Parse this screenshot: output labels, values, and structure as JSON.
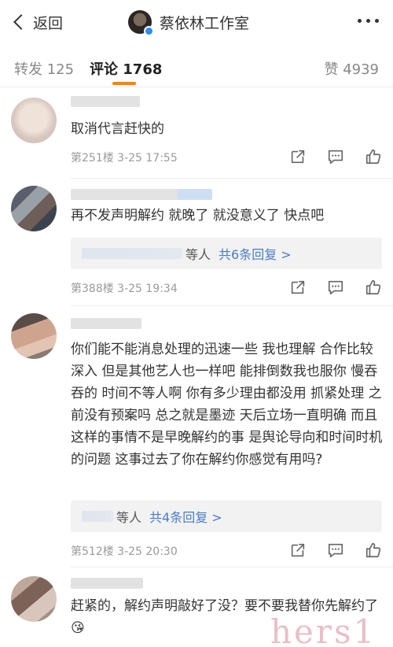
{
  "header": {
    "back_label": "返回",
    "title": "蔡依林工作室"
  },
  "tabs": [
    {
      "label": "转发 125",
      "active": false
    },
    {
      "label": "评论 1768",
      "active": true
    },
    {
      "label": "赞 4939",
      "active": false
    }
  ],
  "comments": [
    {
      "text": "取消代言赶快的",
      "meta": "第251楼  3-25 17:55"
    },
    {
      "text": "再不发声明解约 就晚了 就没意义了 快点吧",
      "reply_deng": "等人",
      "reply_link": "共6条回复 >",
      "meta": "第388楼  3-25 19:34"
    },
    {
      "text": "你们能不能消息处理的迅速一些 我也理解 合作比较深入 但是其他艺人也一样吧 能排倒数我也服你 慢吞吞的 时间不等人啊 你有多少理由都没用 抓紧处理 之前没有预案吗 总之就是墨迹 天后立场一直明确 而且这样的事情不是早晚解约的事 是舆论导向和时间时机的问题 这事过去了你在解约你感觉有用吗?",
      "reply_deng": "等人",
      "reply_link": "共4条回复 >",
      "meta": "第512楼  3-25 20:30"
    },
    {
      "text": "赶紧的，解约声明敲好了没？要不要我替你先解约了😘"
    }
  ],
  "watermark": "hers1",
  "colors": {
    "accent": "#ff8200",
    "link": "#4a7cc8",
    "meta_text": "#9a9a9a"
  },
  "icons": [
    "back-chevron-icon",
    "verified-badge-icon",
    "more-dots-icon",
    "share-icon",
    "comment-icon",
    "like-thumb-icon"
  ]
}
